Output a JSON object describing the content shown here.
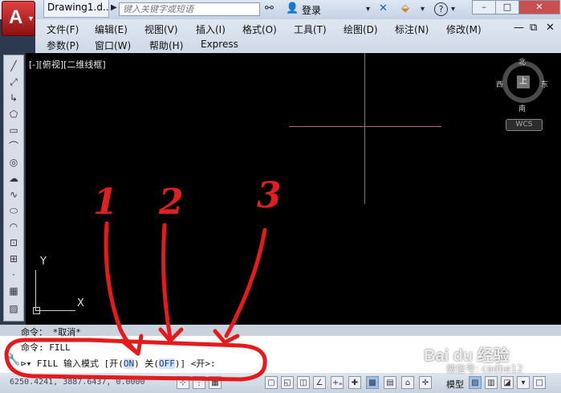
{
  "title_bar": {
    "doc_tab": "Drawing1.d...",
    "search_placeholder": "键入关键字或短语",
    "login": "登录",
    "help": "?"
  },
  "menu": {
    "row1": [
      "文件(F)",
      "编辑(E)",
      "视图(V)",
      "插入(I)",
      "格式(O)",
      "工具(T)",
      "绘图(D)",
      "标注(N)",
      "修改(M)"
    ],
    "row2": [
      "参数(P)",
      "窗口(W)",
      "帮助(H)",
      "Express"
    ]
  },
  "viewport": {
    "label": "[-][俯视][二维线框]",
    "compass": {
      "north": "北",
      "south": "南",
      "west": "西",
      "east": "东",
      "center": "上"
    },
    "wcs": "WCS",
    "ucs_x": "X",
    "ucs_y": "Y"
  },
  "command": {
    "history1": "命令：  *取消*",
    "history2": "命令: FILL",
    "prompt_prefix": "FILL 输入模式 [开(",
    "on_kw": "ON",
    "mid": ") 关(",
    "off_kw": "OFF",
    "suffix": ")] <开>:"
  },
  "status": {
    "coords": "6250.4241, 3887.6437, 0.0000",
    "model": "模型"
  },
  "annotations": {
    "n1": "1",
    "n2": "2",
    "n3": "3"
  },
  "watermark": {
    "text1": "Bai du 经验",
    "text2": "微信号: cadbe12"
  }
}
